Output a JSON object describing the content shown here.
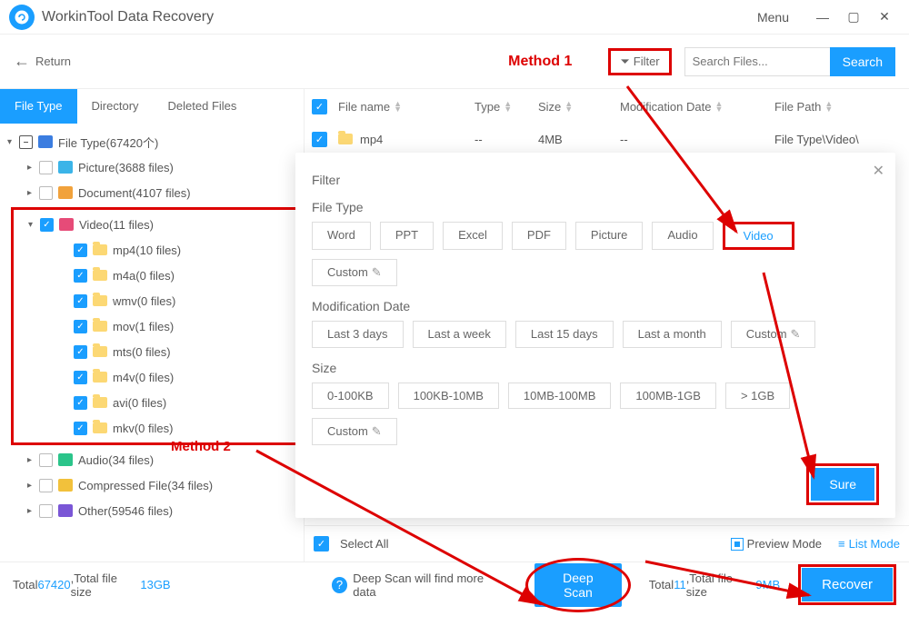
{
  "app": {
    "title": "WorkinTool Data Recovery",
    "menu": "Menu"
  },
  "toolbar": {
    "return": "Return",
    "method1": "Method 1",
    "filter": "Filter",
    "search_placeholder": "Search Files...",
    "search": "Search"
  },
  "sidebar": {
    "tabs": [
      "File Type",
      "Directory",
      "Deleted Files"
    ],
    "root": "File Type(67420个)",
    "categories": {
      "picture": "Picture(3688 files)",
      "document": "Document(4107 files)",
      "video": "Video(11 files)",
      "audio": "Audio(34 files)",
      "compressed": "Compressed File(34 files)",
      "other": "Other(59546 files)"
    },
    "video_items": [
      "mp4(10 files)",
      "m4a(0 files)",
      "wmv(0 files)",
      "mov(1 files)",
      "mts(0 files)",
      "m4v(0 files)",
      "avi(0 files)",
      "mkv(0 files)"
    ],
    "method2": "Method 2"
  },
  "table": {
    "head": {
      "name": "File name",
      "type": "Type",
      "size": "Size",
      "mod": "Modification Date",
      "path": "File Path"
    },
    "row0": {
      "name": "mp4",
      "type": "--",
      "size": "4MB",
      "mod": "--",
      "path": "File Type\\Video\\"
    }
  },
  "dialog": {
    "title": "Filter",
    "sec_filetype": "File Type",
    "types": [
      "Word",
      "PPT",
      "Excel",
      "PDF",
      "Picture",
      "Audio",
      "Video",
      "Custom"
    ],
    "sec_moddate": "Modification Date",
    "dates": [
      "Last 3 days",
      "Last a week",
      "Last 15 days",
      "Last a month",
      "Custom"
    ],
    "sec_size": "Size",
    "sizes": [
      "0-100KB",
      "100KB-10MB",
      "10MB-100MB",
      "100MB-1GB",
      "> 1GB",
      "Custom"
    ],
    "sure": "Sure"
  },
  "under": {
    "select_all": "Select All",
    "preview": "Preview Mode",
    "list": "List Mode"
  },
  "footer": {
    "total_label": "Total ",
    "total_n": "67420",
    "total_size_label": ",Total file size ",
    "total_size": "13GB",
    "deep_hint": "Deep Scan will find more data",
    "deep_scan": "Deep Scan",
    "total2_a": "Total ",
    "total2_n": "11",
    "total2_b": ",Total file size ",
    "total2_size": "9MB",
    "recover": "Recover"
  }
}
